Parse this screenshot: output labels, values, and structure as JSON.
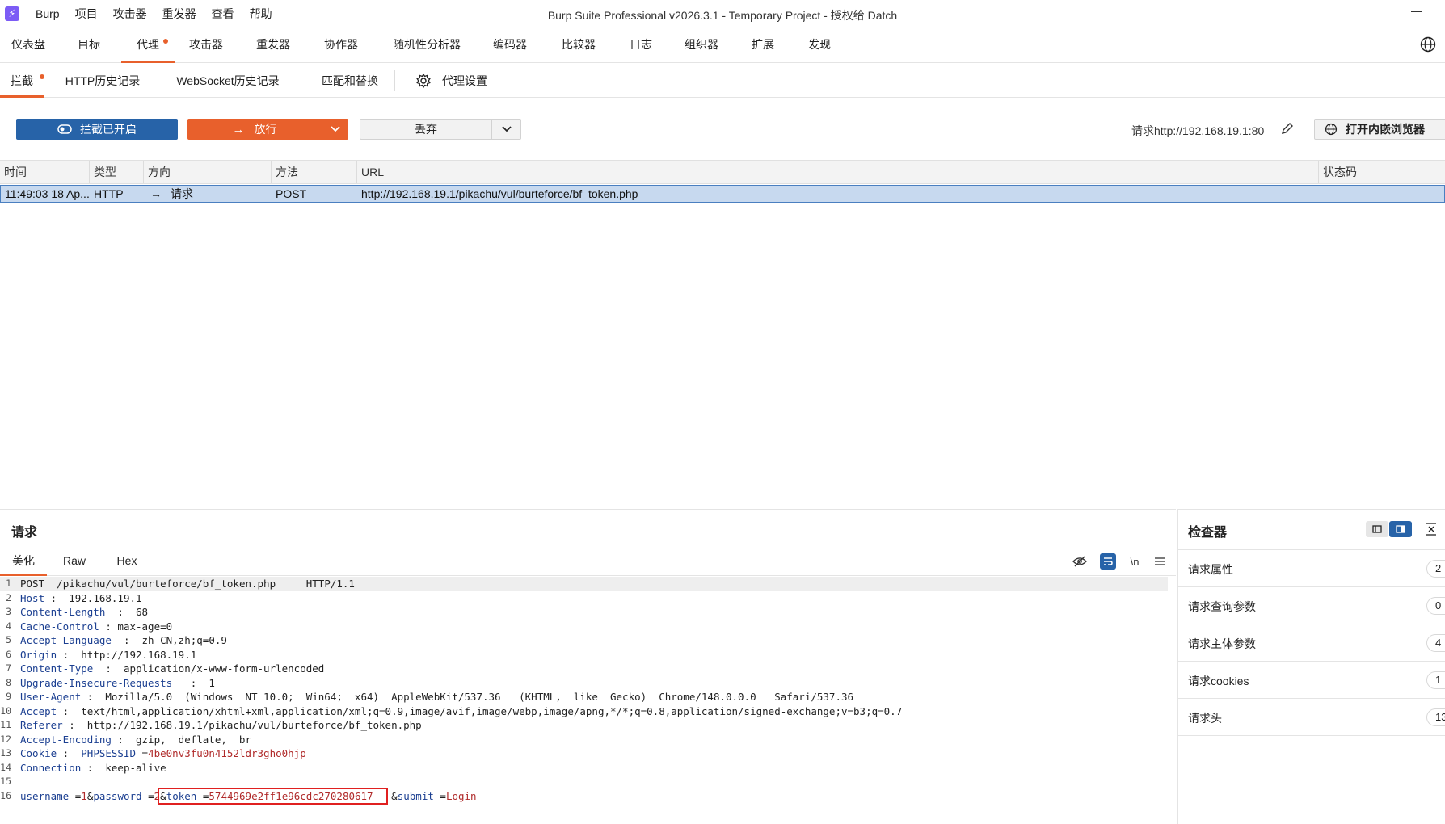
{
  "window": {
    "title": "Burp Suite Professional v2026.3.1 - Temporary Project - 授权给 Datch",
    "menu": [
      "Burp",
      "项目",
      "攻击器",
      "重发器",
      "查看",
      "帮助"
    ]
  },
  "main_tabs": [
    "仪表盘",
    "目标",
    "代理",
    "攻击器",
    "重发器",
    "协作器",
    "随机性分析器",
    "编码器",
    "比较器",
    "日志",
    "组织器",
    "扩展",
    "发现"
  ],
  "main_tabs_active": "代理",
  "sub_tabs": [
    "拦截",
    "HTTP历史记录",
    "WebSocket历史记录",
    "匹配和替换",
    "代理设置"
  ],
  "sub_tabs_active": "拦截",
  "toolbar": {
    "intercept_label": "拦截已开启",
    "forward_label": "放行",
    "drop_label": "丢弃",
    "request_target": "请求http://192.168.19.1:80",
    "open_browser_label": "打开内嵌浏览器"
  },
  "table": {
    "columns": [
      "时间",
      "类型",
      "方向",
      "方法",
      "URL",
      "状态码"
    ],
    "rows": [
      {
        "time": "11:49:03 18 Ap...",
        "type": "HTTP",
        "direction": "请求",
        "method": "POST",
        "url": "http://192.168.19.1/pikachu/vul/burteforce/bf_token.php",
        "status": ""
      }
    ]
  },
  "request_panel": {
    "title": "请求",
    "view_tabs": [
      "美化",
      "Raw",
      "Hex"
    ],
    "view_tabs_active": "美化",
    "newline_toggle": "\\n"
  },
  "request": {
    "request_line": {
      "method": "POST",
      "path": "/pikachu/vul/burteforce/bf_token.php",
      "version": "HTTP/1.1"
    },
    "headers": [
      {
        "name": "Host",
        "value": "192.168.19.1"
      },
      {
        "name": "Content-Length",
        "value": "68"
      },
      {
        "name": "Cache-Control",
        "value": "max-age=0"
      },
      {
        "name": "Accept-Language",
        "value": "zh-CN,zh;q=0.9"
      },
      {
        "name": "Origin",
        "value": "http://192.168.19.1"
      },
      {
        "name": "Content-Type",
        "value": "application/x-www-form-urlencoded"
      },
      {
        "name": "Upgrade-Insecure-Requests",
        "value": "1"
      },
      {
        "name": "User-Agent",
        "value": "Mozilla/5.0  (Windows  NT 10.0;  Win64;  x64)  AppleWebKit/537.36   (KHTML,  like  Gecko)  Chrome/148.0.0.0   Safari/537.36"
      },
      {
        "name": "Accept",
        "value": "text/html,application/xhtml+xml,application/xml;q=0.9,image/avif,image/webp,image/apng,*/*;q=0.8,application/signed-exchange;v=b3;q=0.7"
      },
      {
        "name": "Referer",
        "value": "http://192.168.19.1/pikachu/vul/burteforce/bf_token.php"
      },
      {
        "name": "Accept-Encoding",
        "value": "gzip,  deflate,  br"
      },
      {
        "name": "Cookie",
        "cookie_name": "PHPSESSID",
        "cookie_value": "4be0nv3fu0n4152ldr3gho0hjp"
      },
      {
        "name": "Connection",
        "value": "keep-alive"
      }
    ],
    "line_numbers": [
      "1",
      "2",
      "3",
      "4",
      "5",
      "6",
      "7",
      "8",
      "9",
      "10",
      "11",
      "12",
      "13",
      "14",
      "15",
      "16"
    ],
    "body": [
      {
        "name": "username",
        "value": "1"
      },
      {
        "name": "password",
        "value": "2"
      },
      {
        "name": "token",
        "value": "5744969e2ff1e96cdc270280617"
      },
      {
        "name": "submit",
        "value": "Login"
      }
    ]
  },
  "inspector": {
    "title": "检查器",
    "items": [
      {
        "label": "请求属性",
        "count": "2"
      },
      {
        "label": "请求查询参数",
        "count": "0"
      },
      {
        "label": "请求主体参数",
        "count": "4"
      },
      {
        "label": "请求cookies",
        "count": "1"
      },
      {
        "label": "请求头",
        "count": "13"
      }
    ]
  },
  "colors": {
    "accent": "#e8602c",
    "primary": "#2763a8",
    "selection": "#c7d9ef",
    "header_key": "#1b3f91",
    "param_value": "#b02a2a",
    "highlight_box": "#e02020"
  }
}
